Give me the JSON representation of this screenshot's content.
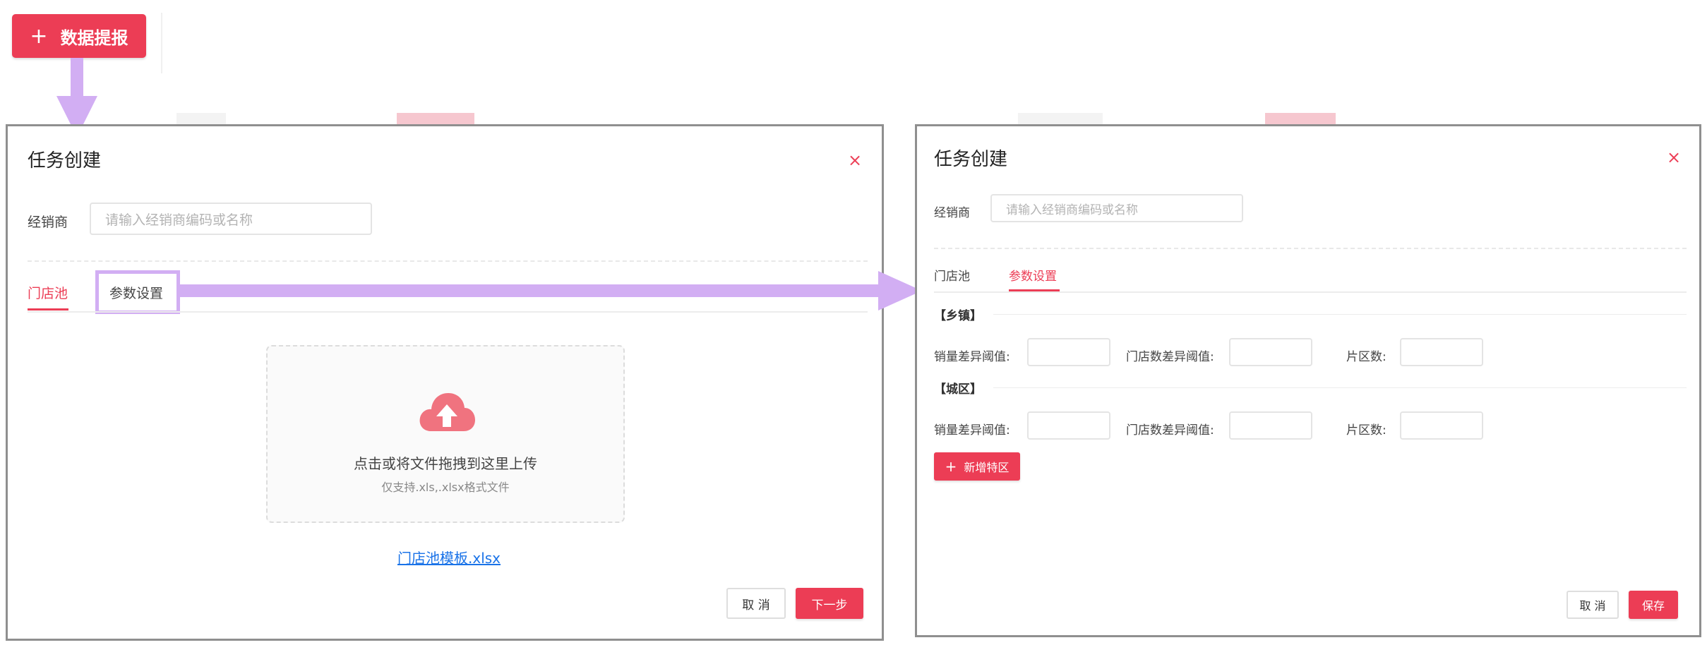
{
  "top_button": {
    "icon": "plus-icon",
    "label": "数据提报"
  },
  "dialog_upload": {
    "title": "任务创建",
    "close_icon": "×",
    "dealer_label": "经销商",
    "dealer_placeholder": "请输入经销商编码或名称",
    "tabs": [
      "门店池",
      "参数设置"
    ],
    "active_tab": "门店池",
    "upload": {
      "icon": "cloud-upload-icon",
      "main_text": "点击或将文件拖拽到这里上传",
      "sub_text": "仅支持.xls,.xlsx格式文件"
    },
    "template_link": "门店池模板.xlsx",
    "cancel_label": "取 消",
    "next_label": "下一步"
  },
  "dialog_params": {
    "title": "任务创建",
    "close_icon": "×",
    "dealer_label": "经销商",
    "dealer_placeholder": "请输入经销商编码或名称",
    "tabs": [
      "门店池",
      "参数设置"
    ],
    "active_tab": "参数设置",
    "sections": [
      {
        "title": "【乡镇】",
        "fields": [
          "销量差异阈值:",
          "门店数差异阈值:",
          "片区数:"
        ]
      },
      {
        "title": "【城区】",
        "fields": [
          "销量差异阈值:",
          "门店数差异阈值:",
          "片区数:"
        ]
      }
    ],
    "add_button": {
      "icon": "plus-icon",
      "label": "新增特区"
    },
    "cancel_label": "取 消",
    "save_label": "保存"
  },
  "colors": {
    "accent": "#ec3d55",
    "annotation": "#d2aef3",
    "link": "#1a73e8"
  }
}
